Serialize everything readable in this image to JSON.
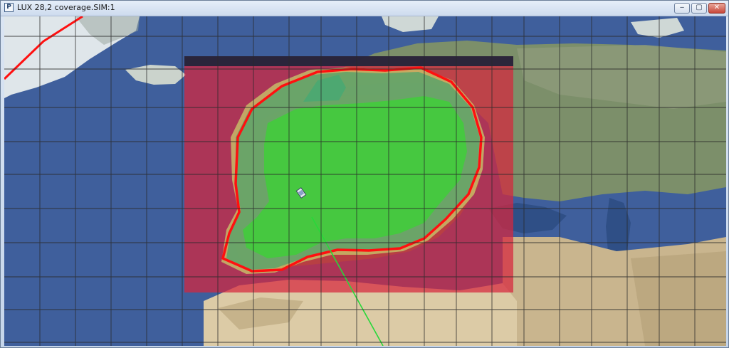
{
  "window": {
    "title": "LUX 28,2 coverage.SIM:1",
    "app_icon_glyph": "P",
    "controls": {
      "minimize_glyph": "‒",
      "maximize_glyph": "▢",
      "close_glyph": "✕"
    }
  },
  "map": {
    "colors": {
      "ocean": "#3f5f9c",
      "land": "#7f8a5a",
      "desert": "#d9c8a4",
      "ice": "#e9eef2",
      "coverage_outer": "#d7263d",
      "coverage_mid": "#5aa36a",
      "coverage_inner": "#3fcf3a",
      "contour": "#ff1010",
      "contour_yellow": "#d8d86a",
      "ground_track": "#28d83a",
      "grid": "#2a2a2a"
    },
    "icons": [
      "satellite-icon"
    ]
  }
}
